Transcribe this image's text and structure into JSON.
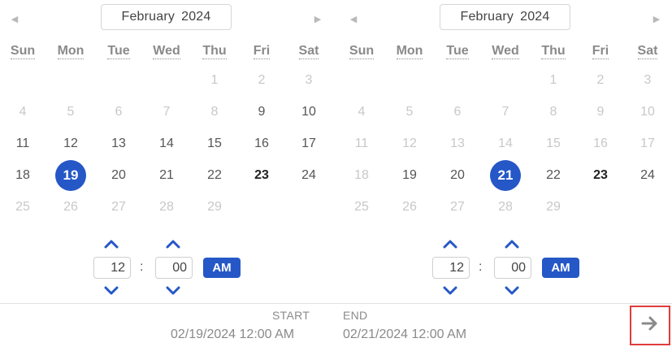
{
  "calendars": [
    {
      "id": "start",
      "month_label": "February",
      "year_label": "2024",
      "nav": {
        "prev_icon": "◀",
        "next_icon": "▶"
      },
      "weekdays": [
        "Sun",
        "Mon",
        "Tue",
        "Wed",
        "Thu",
        "Fri",
        "Sat"
      ],
      "weeks": [
        [
          null,
          null,
          null,
          null,
          {
            "d": "1",
            "s": "disabled"
          },
          {
            "d": "2",
            "s": "disabled"
          },
          {
            "d": "3",
            "s": "disabled"
          }
        ],
        [
          {
            "d": "4",
            "s": "disabled"
          },
          {
            "d": "5",
            "s": "disabled"
          },
          {
            "d": "6",
            "s": "disabled"
          },
          {
            "d": "7",
            "s": "disabled"
          },
          {
            "d": "8",
            "s": "disabled"
          },
          {
            "d": "9",
            "s": "enabled"
          },
          {
            "d": "10",
            "s": "enabled"
          }
        ],
        [
          {
            "d": "11",
            "s": "enabled"
          },
          {
            "d": "12",
            "s": "enabled"
          },
          {
            "d": "13",
            "s": "enabled"
          },
          {
            "d": "14",
            "s": "enabled"
          },
          {
            "d": "15",
            "s": "enabled"
          },
          {
            "d": "16",
            "s": "enabled"
          },
          {
            "d": "17",
            "s": "enabled"
          }
        ],
        [
          {
            "d": "18",
            "s": "enabled"
          },
          {
            "d": "19",
            "s": "selected"
          },
          {
            "d": "20",
            "s": "enabled"
          },
          {
            "d": "21",
            "s": "enabled"
          },
          {
            "d": "22",
            "s": "enabled"
          },
          {
            "d": "23",
            "s": "today"
          },
          {
            "d": "24",
            "s": "enabled"
          }
        ],
        [
          {
            "d": "25",
            "s": "disabled"
          },
          {
            "d": "26",
            "s": "disabled"
          },
          {
            "d": "27",
            "s": "disabled"
          },
          {
            "d": "28",
            "s": "disabled"
          },
          {
            "d": "29",
            "s": "disabled"
          },
          null,
          null
        ]
      ],
      "time": {
        "hour": "12",
        "minute": "00",
        "separator": ":",
        "ampm": "AM"
      }
    },
    {
      "id": "end",
      "month_label": "February",
      "year_label": "2024",
      "nav": {
        "prev_icon": "◀",
        "next_icon": "▶"
      },
      "weekdays": [
        "Sun",
        "Mon",
        "Tue",
        "Wed",
        "Thu",
        "Fri",
        "Sat"
      ],
      "weeks": [
        [
          null,
          null,
          null,
          null,
          {
            "d": "1",
            "s": "disabled"
          },
          {
            "d": "2",
            "s": "disabled"
          },
          {
            "d": "3",
            "s": "disabled"
          }
        ],
        [
          {
            "d": "4",
            "s": "disabled"
          },
          {
            "d": "5",
            "s": "disabled"
          },
          {
            "d": "6",
            "s": "disabled"
          },
          {
            "d": "7",
            "s": "disabled"
          },
          {
            "d": "8",
            "s": "disabled"
          },
          {
            "d": "9",
            "s": "disabled"
          },
          {
            "d": "10",
            "s": "disabled"
          }
        ],
        [
          {
            "d": "11",
            "s": "disabled"
          },
          {
            "d": "12",
            "s": "disabled"
          },
          {
            "d": "13",
            "s": "disabled"
          },
          {
            "d": "14",
            "s": "disabled"
          },
          {
            "d": "15",
            "s": "disabled"
          },
          {
            "d": "16",
            "s": "disabled"
          },
          {
            "d": "17",
            "s": "disabled"
          }
        ],
        [
          {
            "d": "18",
            "s": "disabled"
          },
          {
            "d": "19",
            "s": "enabled"
          },
          {
            "d": "20",
            "s": "enabled"
          },
          {
            "d": "21",
            "s": "selected"
          },
          {
            "d": "22",
            "s": "enabled"
          },
          {
            "d": "23",
            "s": "today"
          },
          {
            "d": "24",
            "s": "enabled"
          }
        ],
        [
          {
            "d": "25",
            "s": "disabled"
          },
          {
            "d": "26",
            "s": "disabled"
          },
          {
            "d": "27",
            "s": "disabled"
          },
          {
            "d": "28",
            "s": "disabled"
          },
          {
            "d": "29",
            "s": "disabled"
          },
          null,
          null
        ]
      ],
      "time": {
        "hour": "12",
        "minute": "00",
        "separator": ":",
        "ampm": "AM"
      }
    }
  ],
  "summary": {
    "start_label": "START",
    "start_value": "02/19/2024 12:00 AM",
    "end_label": "END",
    "end_value": "02/21/2024 12:00 AM"
  },
  "apply_button": {
    "icon": "arrow-right-icon"
  },
  "colors": {
    "accent": "#2557c7",
    "disabled_text": "#c8c8c8",
    "weekday_text": "#8a8a8a",
    "highlight_border": "#e03c3c"
  }
}
